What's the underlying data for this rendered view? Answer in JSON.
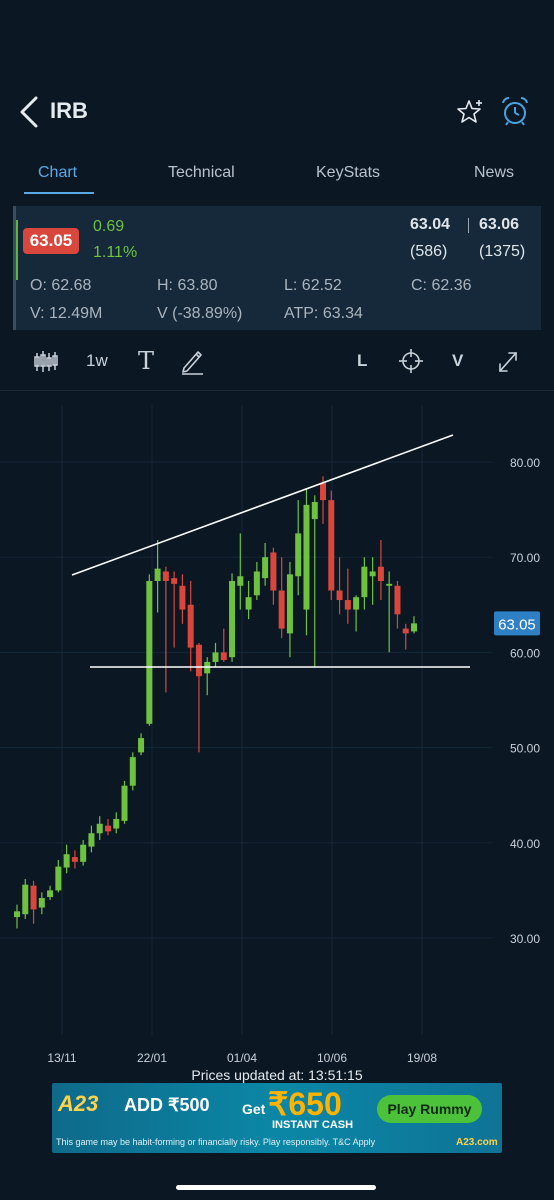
{
  "header": {
    "title": "IRB"
  },
  "tabs": [
    {
      "label": "Chart",
      "active": true
    },
    {
      "label": "Technical",
      "active": false
    },
    {
      "label": "KeyStats",
      "active": false
    },
    {
      "label": "News",
      "active": false
    }
  ],
  "quote": {
    "price": "63.05",
    "change": "0.69",
    "change_pct": "1.11%",
    "bid": "63.04",
    "ask": "63.06",
    "bid_qty": "(586)",
    "ask_qty": "(1375)",
    "open": "O: 62.68",
    "high": "H: 63.80",
    "low": "L: 62.52",
    "close": "C: 62.36",
    "volume": "V: 12.49M",
    "volume_change": "V (-38.89%)",
    "atp": "ATP: 63.34"
  },
  "toolbar": {
    "interval": "1w",
    "text_tool": "T",
    "log_button": "L",
    "volume_button": "V"
  },
  "colors": {
    "background": "#0b1824",
    "accent": "#5aa9e6",
    "up": "#6ec23f",
    "down": "#d9463b"
  },
  "chart_data": {
    "type": "candlestick",
    "yticks": [
      "80.00",
      "70.00",
      "60.00",
      "50.00",
      "40.00",
      "30.00"
    ],
    "xticks": [
      "13/11",
      "22/01",
      "01/04",
      "10/06",
      "19/08"
    ],
    "ylim": [
      26,
      86
    ],
    "last_price_label": "63.05",
    "candles": [
      {
        "o": 32.2,
        "h": 33.5,
        "l": 31.0,
        "c": 32.8
      },
      {
        "o": 32.5,
        "h": 36.2,
        "l": 32.0,
        "c": 35.6
      },
      {
        "o": 35.5,
        "h": 36.0,
        "l": 31.5,
        "c": 33.0
      },
      {
        "o": 33.2,
        "h": 34.8,
        "l": 32.5,
        "c": 34.2
      },
      {
        "o": 34.3,
        "h": 35.5,
        "l": 34.0,
        "c": 35.0
      },
      {
        "o": 35.0,
        "h": 38.2,
        "l": 34.8,
        "c": 37.5
      },
      {
        "o": 37.4,
        "h": 39.8,
        "l": 36.8,
        "c": 38.8
      },
      {
        "o": 38.5,
        "h": 39.2,
        "l": 37.3,
        "c": 38.0
      },
      {
        "o": 38.0,
        "h": 40.3,
        "l": 37.6,
        "c": 39.8
      },
      {
        "o": 39.6,
        "h": 41.8,
        "l": 39.0,
        "c": 41.0
      },
      {
        "o": 41.0,
        "h": 42.8,
        "l": 40.3,
        "c": 42.0
      },
      {
        "o": 41.8,
        "h": 42.5,
        "l": 40.8,
        "c": 41.2
      },
      {
        "o": 41.5,
        "h": 43.2,
        "l": 41.0,
        "c": 42.5
      },
      {
        "o": 42.3,
        "h": 46.5,
        "l": 42.0,
        "c": 46.0
      },
      {
        "o": 46.0,
        "h": 49.5,
        "l": 45.5,
        "c": 49.0
      },
      {
        "o": 49.5,
        "h": 51.5,
        "l": 49.2,
        "c": 51.0
      },
      {
        "o": 52.5,
        "h": 68.2,
        "l": 52.3,
        "c": 67.5
      },
      {
        "o": 67.5,
        "h": 71.8,
        "l": 64.2,
        "c": 68.8
      },
      {
        "o": 68.5,
        "h": 69.0,
        "l": 55.8,
        "c": 67.5
      },
      {
        "o": 67.8,
        "h": 68.5,
        "l": 60.5,
        "c": 67.2
      },
      {
        "o": 67.0,
        "h": 68.2,
        "l": 63.0,
        "c": 64.5
      },
      {
        "o": 65.0,
        "h": 67.5,
        "l": 58.0,
        "c": 60.5
      },
      {
        "o": 60.8,
        "h": 61.0,
        "l": 49.5,
        "c": 57.5
      },
      {
        "o": 57.8,
        "h": 59.5,
        "l": 55.5,
        "c": 59.0
      },
      {
        "o": 59.0,
        "h": 61.0,
        "l": 58.5,
        "c": 60.0
      },
      {
        "o": 60.0,
        "h": 62.5,
        "l": 59.0,
        "c": 59.2
      },
      {
        "o": 59.5,
        "h": 68.3,
        "l": 59.0,
        "c": 67.5
      },
      {
        "o": 67.0,
        "h": 72.5,
        "l": 64.5,
        "c": 68.0
      },
      {
        "o": 64.5,
        "h": 67.5,
        "l": 63.5,
        "c": 65.8
      },
      {
        "o": 66.0,
        "h": 69.5,
        "l": 65.5,
        "c": 68.5
      },
      {
        "o": 67.8,
        "h": 71.5,
        "l": 67.0,
        "c": 70.0
      },
      {
        "o": 70.5,
        "h": 71.0,
        "l": 65.0,
        "c": 66.5
      },
      {
        "o": 66.5,
        "h": 70.0,
        "l": 61.5,
        "c": 62.5
      },
      {
        "o": 62.0,
        "h": 69.5,
        "l": 59.5,
        "c": 68.2
      },
      {
        "o": 68.0,
        "h": 76.0,
        "l": 66.0,
        "c": 72.5
      },
      {
        "o": 64.5,
        "h": 77.2,
        "l": 61.8,
        "c": 75.5
      },
      {
        "o": 74.0,
        "h": 76.5,
        "l": 58.5,
        "c": 75.8
      },
      {
        "o": 77.8,
        "h": 78.5,
        "l": 73.5,
        "c": 76.0
      },
      {
        "o": 76.0,
        "h": 77.0,
        "l": 65.5,
        "c": 66.5
      },
      {
        "o": 66.5,
        "h": 70.0,
        "l": 64.0,
        "c": 65.5
      },
      {
        "o": 65.5,
        "h": 68.8,
        "l": 63.0,
        "c": 64.5
      },
      {
        "o": 64.5,
        "h": 66.0,
        "l": 62.2,
        "c": 65.8
      },
      {
        "o": 65.8,
        "h": 70.0,
        "l": 64.5,
        "c": 69.0
      },
      {
        "o": 68.0,
        "h": 70.0,
        "l": 65.0,
        "c": 68.5
      },
      {
        "o": 69.0,
        "h": 71.8,
        "l": 65.5,
        "c": 67.5
      },
      {
        "o": 67.0,
        "h": 68.5,
        "l": 60.0,
        "c": 67.2
      },
      {
        "o": 67.0,
        "h": 67.5,
        "l": 62.5,
        "c": 64.0
      },
      {
        "o": 62.5,
        "h": 63.0,
        "l": 60.3,
        "c": 62.0
      },
      {
        "o": 62.2,
        "h": 63.8,
        "l": 62.0,
        "c": 63.05
      }
    ],
    "trendlines": [
      {
        "from": {
          "index": 0,
          "price": 70.5
        },
        "to": {
          "index": 49,
          "price": 81.5
        }
      },
      {
        "from": {
          "index": 0,
          "price": 58.8
        },
        "to": {
          "index": 49,
          "price": 58.7
        }
      }
    ]
  },
  "status": {
    "updated": "Prices updated at: 13:51:15"
  },
  "ad": {
    "logo": "A23",
    "add_text": "ADD ₹500",
    "get_text": "Get",
    "amount": "₹650",
    "cash_text": "INSTANT CASH",
    "button": "Play Rummy",
    "disclaimer": "This game may be habit-forming or financially risky. Play responsibly. T&C Apply",
    "domain": "A23.com"
  }
}
